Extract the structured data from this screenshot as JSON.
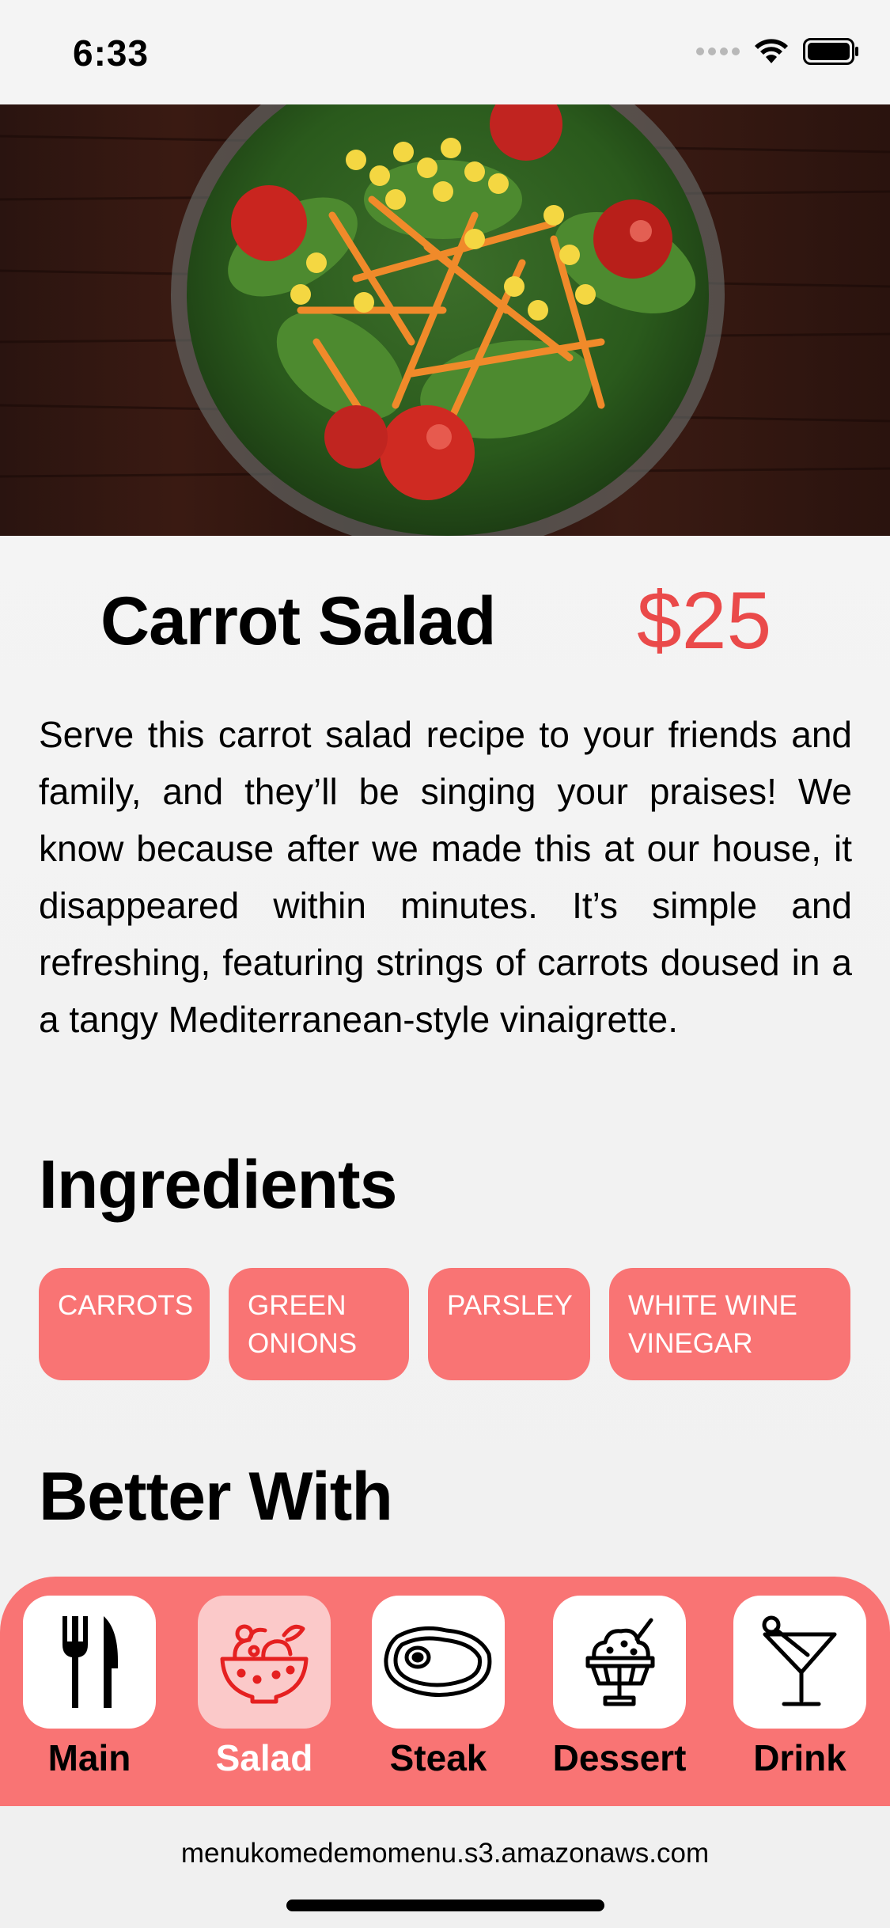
{
  "status_bar": {
    "time": "6:33"
  },
  "hero": {
    "image_icon": "salad-bowl-photo"
  },
  "dish": {
    "name": "Carrot Salad",
    "price": "$25",
    "description": "Serve this carrot salad recipe to your friends and family, and they’ll be singing your praises! We know because after we made this at our house, it disappeared within minutes. It’s simple and refreshing, featuring strings of carrots doused in a a tangy Mediterranean-style vinaigrette."
  },
  "sections": {
    "ingredients": "Ingredients",
    "better_with": "Better With"
  },
  "ingredients": [
    "CARROTS",
    "GREEN\nONIONS",
    "PARSLEY",
    "WHITE WINE\nVINEGAR"
  ],
  "nav": {
    "items": [
      {
        "label": "Main",
        "icon": "fork-knife-icon"
      },
      {
        "label": "Salad",
        "icon": "salad-bowl-icon"
      },
      {
        "label": "Steak",
        "icon": "steak-icon"
      },
      {
        "label": "Dessert",
        "icon": "ice-cream-cup-icon"
      },
      {
        "label": "Drink",
        "icon": "cocktail-icon"
      }
    ],
    "active": "Salad"
  },
  "address_bar": {
    "url": "menukomedemomenu.s3.amazonaws.com"
  },
  "colors": {
    "accent": "#f97474",
    "price": "#ea4a4a",
    "active_tile": "#fbc9c9"
  }
}
